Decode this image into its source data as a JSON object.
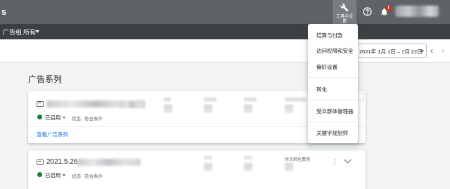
{
  "app": {
    "title_fragment": "s"
  },
  "topbar": {
    "tools_label": "工具与设置",
    "notification_count": "!"
  },
  "breadcrumb": {
    "item1": "广告组",
    "item2": "所有"
  },
  "date_range": {
    "value": "2021年 1月 1日 – 7月 22日"
  },
  "section": {
    "title": "广告系列"
  },
  "campaigns": [
    {
      "name": "",
      "status": "已启用",
      "state_label": "状态:",
      "state_value": "符合条件",
      "link": "查看广告系列"
    },
    {
      "name": "2021.5.26",
      "status": "已启用",
      "state_label": "状态:",
      "state_value": "符合条件",
      "col4_head": "所次转化费用"
    }
  ],
  "dropdown": {
    "items": [
      {
        "label": "结算与付款",
        "icon": "billing"
      },
      {
        "label": "访问权限和安全",
        "icon": "security"
      },
      {
        "label": "偏好设置",
        "icon": "preferences"
      },
      {
        "label": "转化",
        "icon": "conversions"
      },
      {
        "label": "受众群体管理器",
        "icon": "audience"
      },
      {
        "label": "关键字规划师",
        "icon": "keyword-planner"
      }
    ]
  },
  "colors": {
    "topbar": "#5f6368",
    "subbar": "#3c4043",
    "enabled_green": "#188038",
    "link_blue": "#1a73e8",
    "badge_red": "#d93025"
  }
}
